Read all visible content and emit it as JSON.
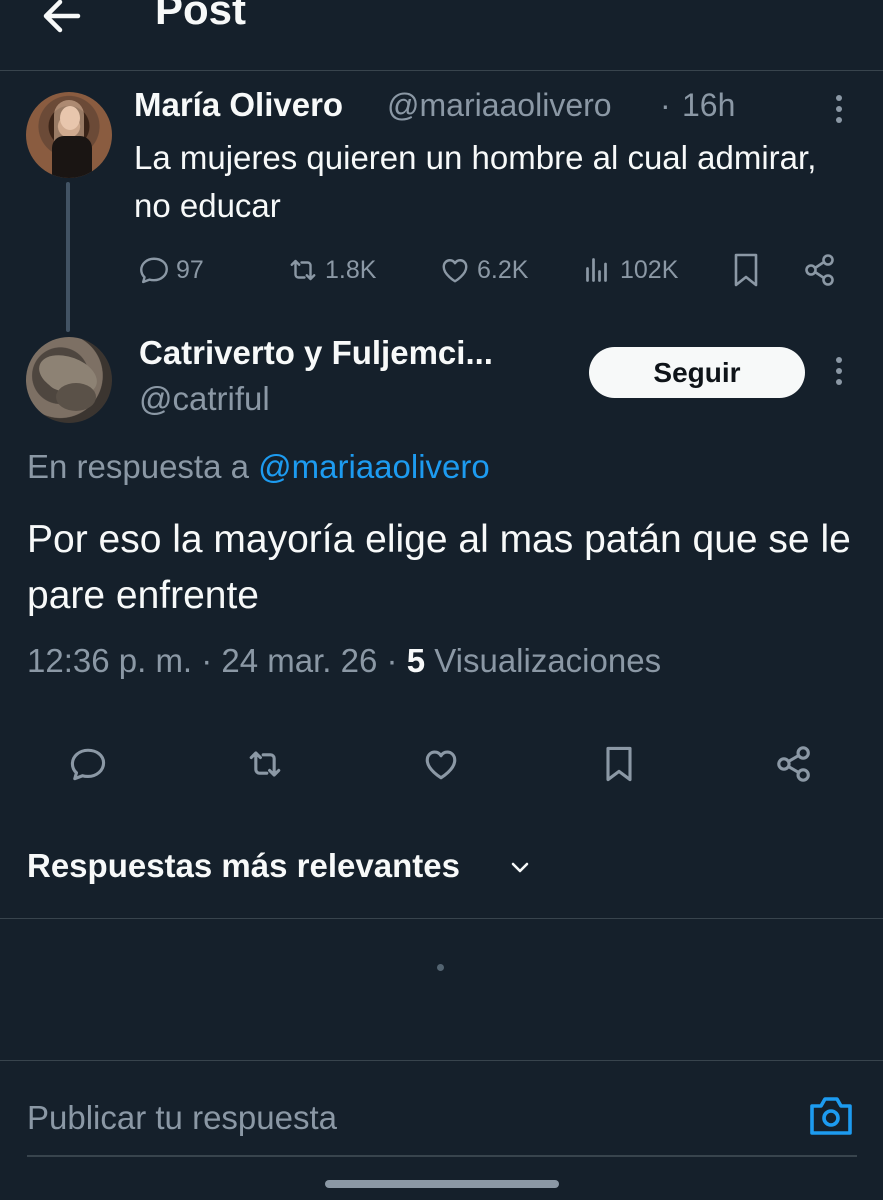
{
  "header": {
    "title": "Post"
  },
  "parent_tweet": {
    "author_name": "María Olivero",
    "handle": "@mariaaolivero",
    "separator": "·",
    "time": "16h",
    "text": "La mujeres quieren un hombre al cual admirar, no educar",
    "stats": {
      "replies": "97",
      "retweets": "1.8K",
      "likes": "6.2K",
      "views": "102K"
    }
  },
  "main_tweet": {
    "author_name": "Catriverto y Fuljemci...",
    "handle": "@catriful",
    "follow_label": "Seguir",
    "reply_prefix": "En respuesta a ",
    "reply_handle": "@mariaaolivero",
    "text": "Por eso la mayoría elige al mas patán que se le pare enfrente",
    "timestamp": "12:36 p. m. · 24 mar. 26 · ",
    "views_count": "5",
    "views_label": " Visualizaciones"
  },
  "replies_section": {
    "sort_label": "Respuestas más relevantes"
  },
  "composer": {
    "placeholder": "Publicar tu respuesta"
  },
  "colors": {
    "background": "#15202b",
    "text": "#f7f9f9",
    "muted": "#8b98a5",
    "accent": "#1d9bf0",
    "divider": "#38444d"
  },
  "icons": [
    "back-arrow-icon",
    "more-vertical-icon",
    "reply-icon",
    "retweet-icon",
    "like-icon",
    "views-icon",
    "bookmark-icon",
    "share-icon",
    "chevron-down-icon",
    "camera-icon"
  ]
}
